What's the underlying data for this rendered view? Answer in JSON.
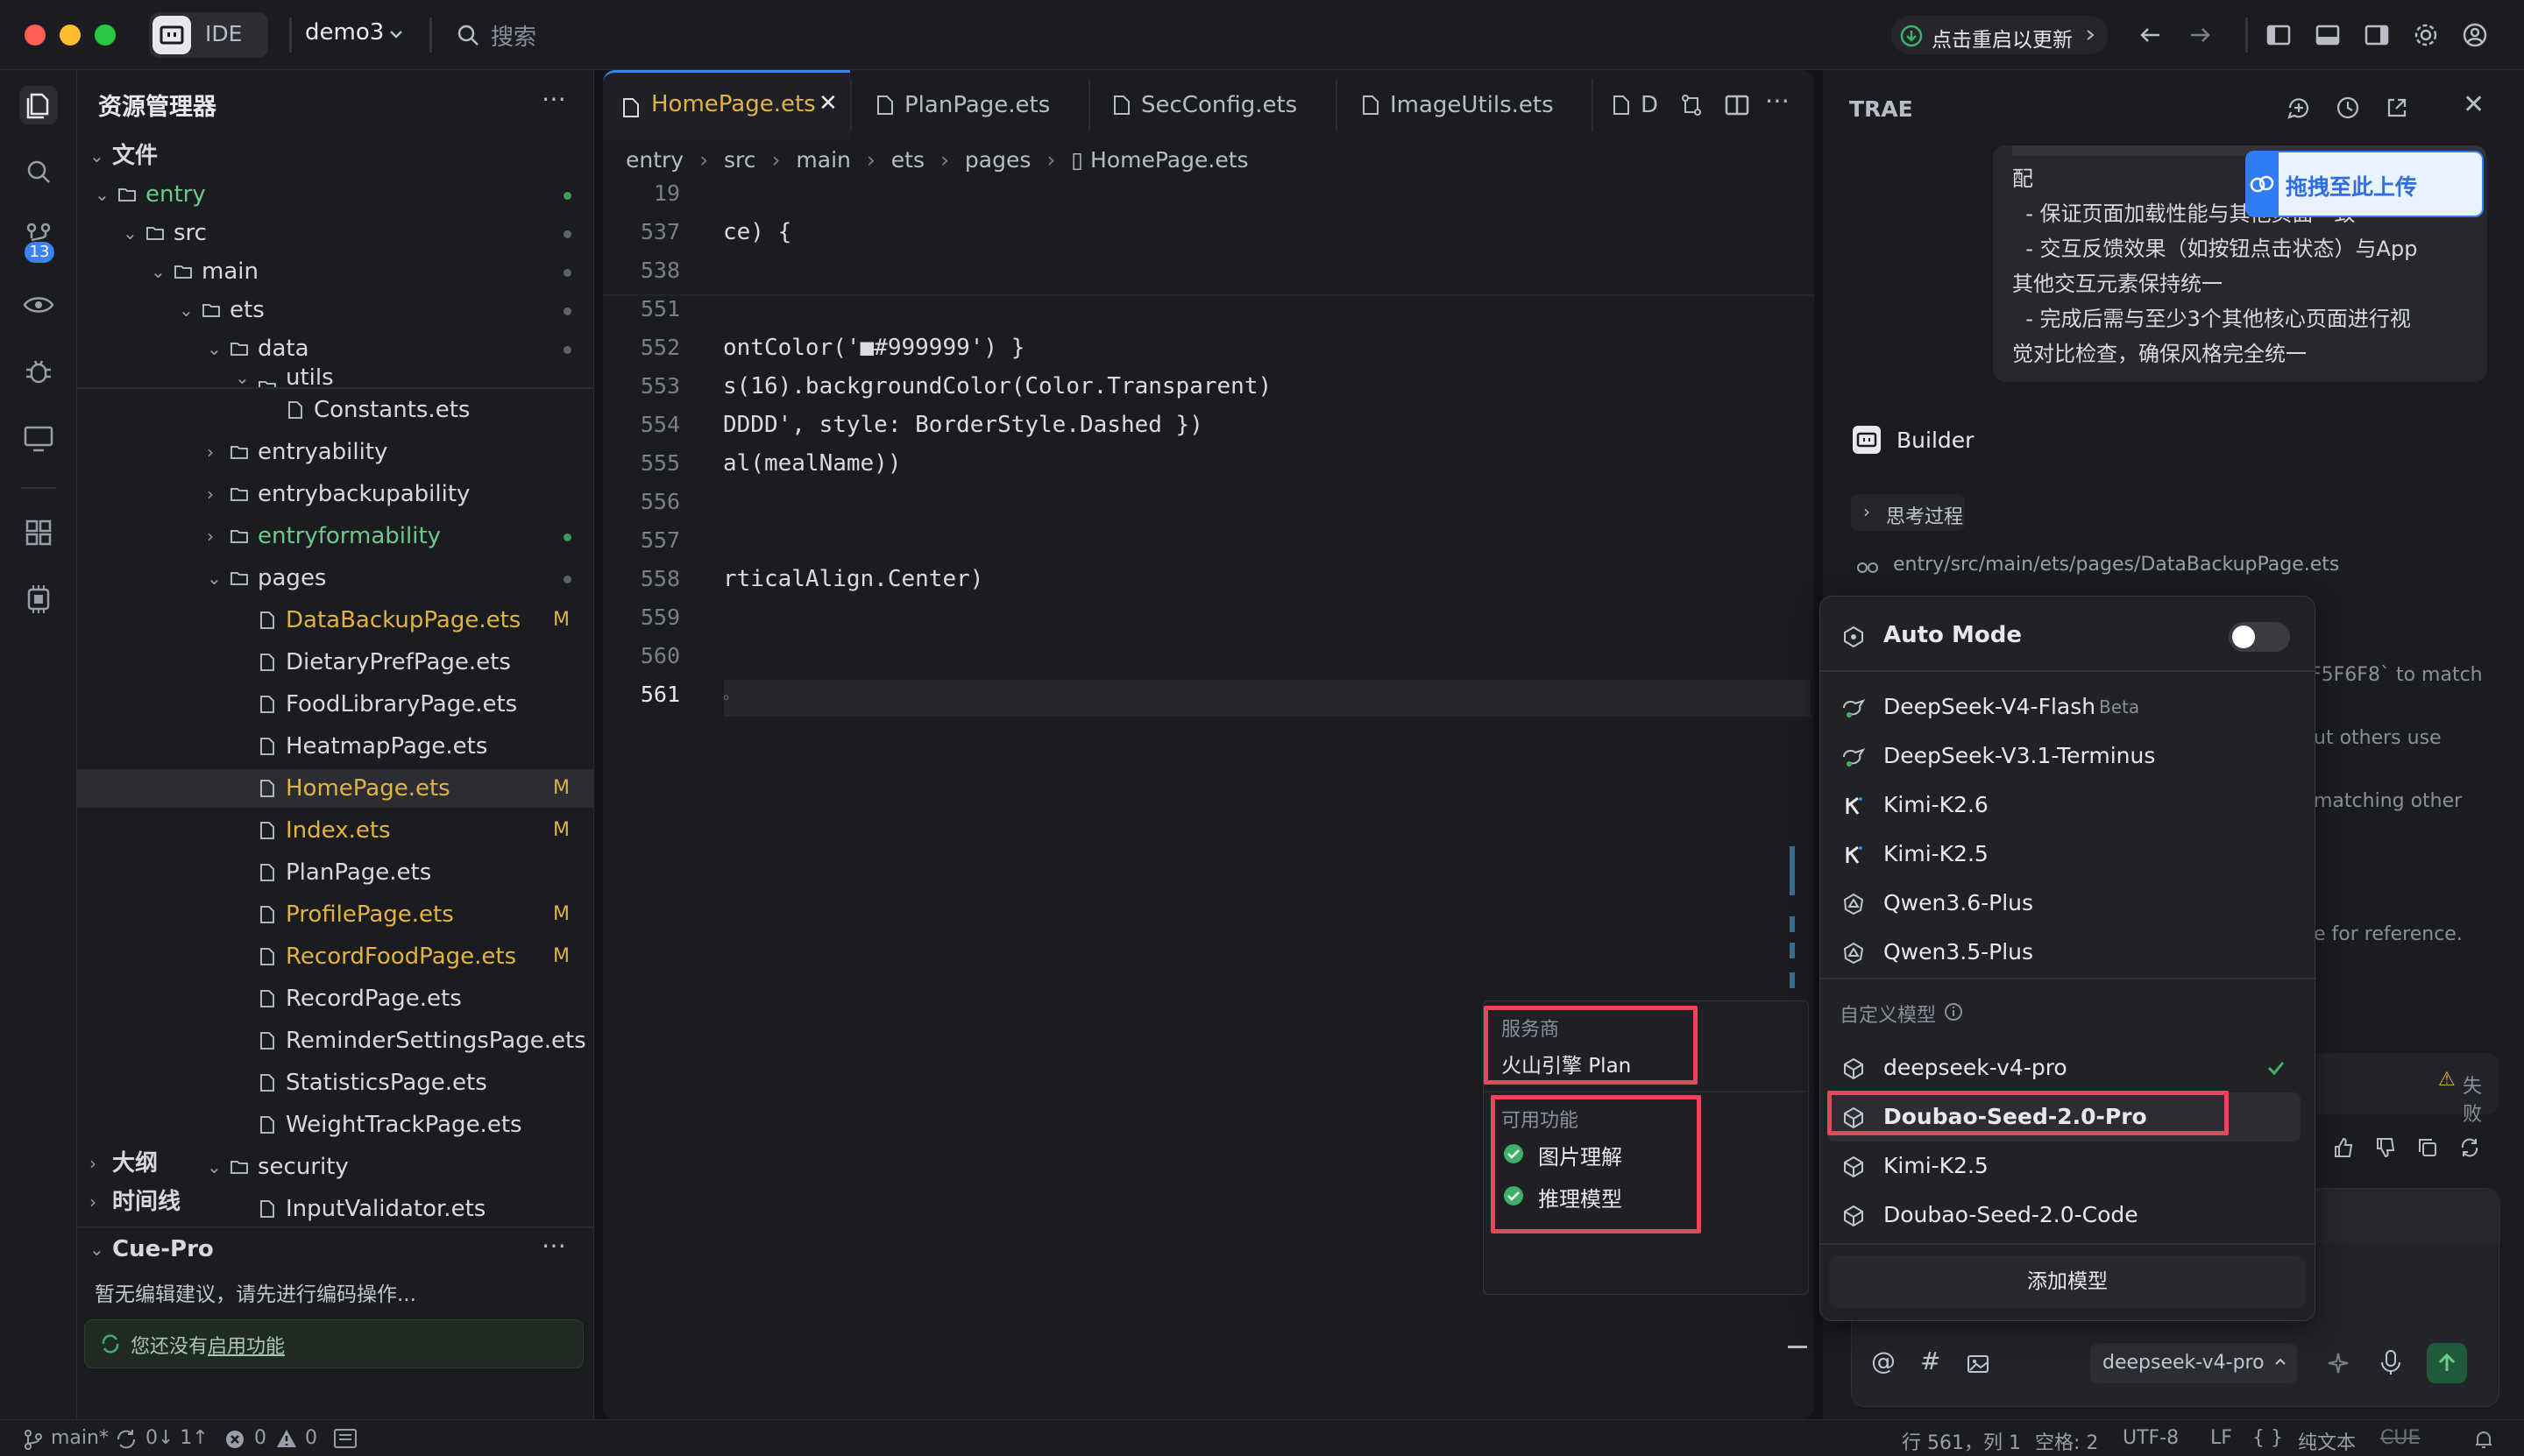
{
  "titlebar": {
    "ide_label": "IDE",
    "project": "demo3",
    "search_placeholder": "搜索",
    "update_label": "点击重启以更新"
  },
  "activity": {
    "source_control_count": "13"
  },
  "sidebar": {
    "title": "资源管理器",
    "root": "文件",
    "tree": [
      {
        "label": "entry",
        "kind": "folder-open"
      },
      {
        "label": "src",
        "kind": "folder-open"
      },
      {
        "label": "main",
        "kind": "folder-open"
      },
      {
        "label": "ets",
        "kind": "folder-open"
      },
      {
        "label": "data",
        "kind": "folder-open"
      },
      {
        "label": "utils",
        "kind": "folder-open"
      },
      {
        "label": "Constants.ets",
        "kind": "file"
      },
      {
        "label": "entryability",
        "kind": "folder"
      },
      {
        "label": "entrybackupability",
        "kind": "folder"
      },
      {
        "label": "entryformability",
        "kind": "folder"
      },
      {
        "label": "pages",
        "kind": "folder-open"
      },
      {
        "label": "DataBackupPage.ets",
        "kind": "file",
        "badge": "M"
      },
      {
        "label": "DietaryPrefPage.ets",
        "kind": "file"
      },
      {
        "label": "FoodLibraryPage.ets",
        "kind": "file"
      },
      {
        "label": "HeatmapPage.ets",
        "kind": "file"
      },
      {
        "label": "HomePage.ets",
        "kind": "file",
        "badge": "M"
      },
      {
        "label": "Index.ets",
        "kind": "file",
        "badge": "M"
      },
      {
        "label": "PlanPage.ets",
        "kind": "file"
      },
      {
        "label": "ProfilePage.ets",
        "kind": "file",
        "badge": "M"
      },
      {
        "label": "RecordFoodPage.ets",
        "kind": "file",
        "badge": "M"
      },
      {
        "label": "RecordPage.ets",
        "kind": "file"
      },
      {
        "label": "ReminderSettingsPage.ets",
        "kind": "file"
      },
      {
        "label": "StatisticsPage.ets",
        "kind": "file"
      },
      {
        "label": "WeightTrackPage.ets",
        "kind": "file"
      },
      {
        "label": "security",
        "kind": "folder-open"
      },
      {
        "label": "InputValidator.ets",
        "kind": "file"
      }
    ],
    "outline": "大纲",
    "timeline": "时间线",
    "cue_title": "Cue-Pro",
    "cue_msg": "暂无编辑建议，请先进行编码操作...",
    "cue_notice_prefix": "您还没有",
    "cue_notice_link": "启用功能"
  },
  "editor": {
    "tabs": [
      "HomePage.ets",
      "PlanPage.ets",
      "SecConfig.ets",
      "ImageUtils.ets",
      "D"
    ],
    "breadcrumb": [
      "entry",
      "src",
      "main",
      "ets",
      "pages",
      "HomePage.ets"
    ],
    "lines": [
      {
        "n": "19",
        "code": ""
      },
      {
        "n": "537",
        "code": "ce) {"
      },
      {
        "n": "538",
        "code": ""
      },
      {
        "n": "551",
        "code": ""
      },
      {
        "n": "552",
        "code": "ontColor('■#999999') }"
      },
      {
        "n": "553",
        "code": "s(16).backgroundColor(Color.Transparent)"
      },
      {
        "n": "554",
        "code": "DDDD', style: BorderStyle.Dashed })"
      },
      {
        "n": "555",
        "code": "al(mealName))"
      },
      {
        "n": "556",
        "code": ""
      },
      {
        "n": "557",
        "code": ""
      },
      {
        "n": "558",
        "code": "rticalAlign.Center)"
      },
      {
        "n": "559",
        "code": ""
      },
      {
        "n": "560",
        "code": ""
      },
      {
        "n": "561",
        "code": "。"
      }
    ]
  },
  "popover": {
    "provider_label": "服务商",
    "provider_value": "火山引擎 Plan",
    "features_label": "可用功能",
    "features": [
      "图片理解",
      "推理模型"
    ]
  },
  "trae": {
    "title": "TRAE",
    "upload_label": "拖拽至此上传",
    "message_lines": [
      "配",
      "  - 保证页面加载性能与其他页面一致",
      "  - 交互反馈效果（如按钮点击状态）与App",
      "其他交互元素保持统一",
      "  - 完成后需与至少3个其他核心页面进行视",
      "觉对比检查，确保风格完全统一"
    ],
    "builder": "Builder",
    "thinking": "思考过程",
    "file_path": "entry/src/main/ets/pages/DataBackupPage.ets",
    "bg_texts": [
      "F5F6F8` to match",
      "ut others use",
      "matching other",
      "e for reference."
    ],
    "fail_label": "失败",
    "input_model": "deepseek-v4-pro"
  },
  "model_menu": {
    "auto_mode": "Auto Mode",
    "models": [
      {
        "name": "DeepSeek-V4-Flash",
        "tag": "Beta"
      },
      {
        "name": "DeepSeek-V3.1-Terminus"
      },
      {
        "name": "Kimi-K2.6"
      },
      {
        "name": "Kimi-K2.5"
      },
      {
        "name": "Qwen3.6-Plus"
      },
      {
        "name": "Qwen3.5-Plus"
      }
    ],
    "custom_label": "自定义模型",
    "custom_models": [
      {
        "name": "deepseek-v4-pro",
        "checked": true
      },
      {
        "name": "Doubao-Seed-2.0-Pro"
      },
      {
        "name": "Kimi-K2.5"
      },
      {
        "name": "Doubao-Seed-2.0-Code"
      }
    ],
    "add_model": "添加模型"
  },
  "statusbar": {
    "branch": "main*",
    "sync": "0↓ 1↑",
    "errors": "0",
    "warnings": "0",
    "position": "行 561，列 1",
    "spaces": "空格: 2",
    "encoding": "UTF-8",
    "eol": "LF",
    "braces": "{ }",
    "lang": "纯文本",
    "cue": "CUE"
  },
  "colors": {
    "accent": "#3b82f6",
    "modified": "#e3b341",
    "highlight": "#e5485b",
    "green": "#3fb068"
  }
}
